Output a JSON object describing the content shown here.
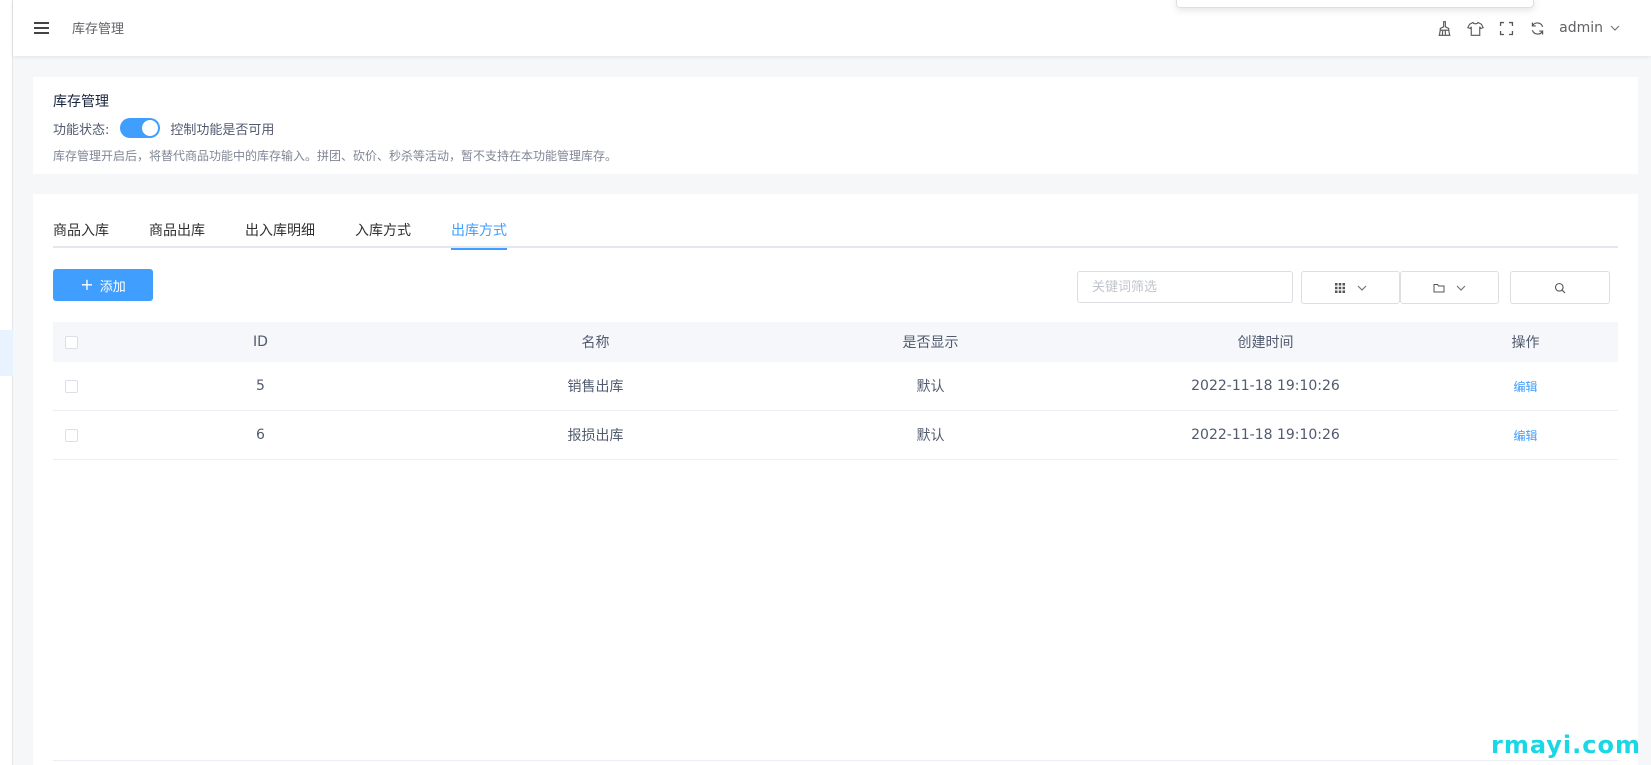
{
  "header": {
    "breadcrumb": "库存管理",
    "user": "admin",
    "icons": [
      "broom-icon",
      "shirt-icon",
      "fullscreen-icon",
      "refresh-icon"
    ]
  },
  "settings": {
    "title": "库存管理",
    "status_label": "功能状态:",
    "switch_on": true,
    "switch_hint": "控制功能是否可用",
    "description": "库存管理开启后，将替代商品功能中的库存输入。拼团、砍价、秒杀等活动，暂不支持在本功能管理库存。"
  },
  "tabs": [
    {
      "label": "商品入库",
      "active": false
    },
    {
      "label": "商品出库",
      "active": false
    },
    {
      "label": "出入库明细",
      "active": false
    },
    {
      "label": "入库方式",
      "active": false
    },
    {
      "label": "出库方式",
      "active": true
    }
  ],
  "toolbar": {
    "add_label": "添加",
    "search_placeholder": "关键词筛选"
  },
  "table": {
    "headers": {
      "id": "ID",
      "name": "名称",
      "show": "是否显示",
      "time": "创建时间",
      "op": "操作"
    },
    "rows": [
      {
        "id": "5",
        "name": "销售出库",
        "show": "默认",
        "time": "2022-11-18 19:10:26",
        "op": "编辑"
      },
      {
        "id": "6",
        "name": "报损出库",
        "show": "默认",
        "time": "2022-11-18 19:10:26",
        "op": "编辑"
      }
    ]
  },
  "watermark": "rmayi.com",
  "colors": {
    "accent": "#409eff",
    "watermark": "#1ad7e6"
  }
}
